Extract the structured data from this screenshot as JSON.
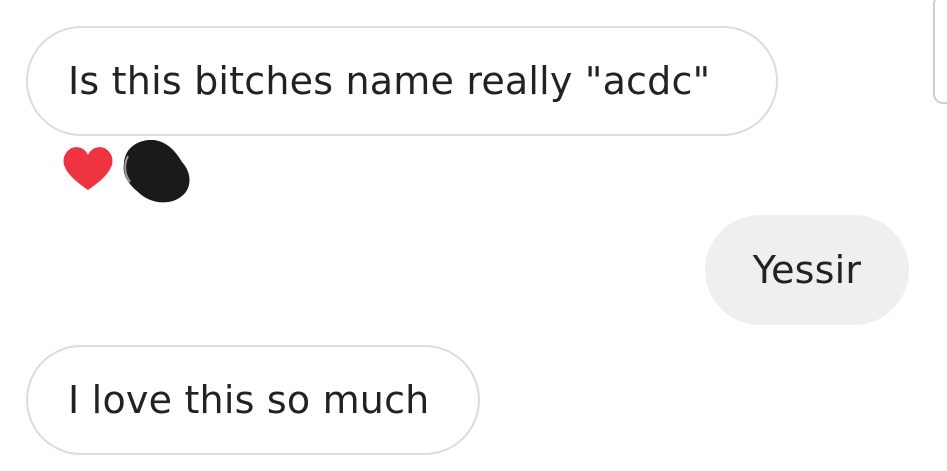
{
  "messages": [
    {
      "direction": "incoming",
      "text": "Is this bitches name really \"acdc\""
    },
    {
      "direction": "outgoing",
      "text": "Yessir"
    },
    {
      "direction": "incoming",
      "text": "I love this so much"
    }
  ],
  "reactions": {
    "first_message": [
      "heart-emoji",
      "redacted-avatar"
    ]
  },
  "colors": {
    "incoming_bubble_bg": "#ffffff",
    "incoming_bubble_border": "#dcdcdc",
    "outgoing_bubble_bg": "#efefef",
    "heart": "#ef3340",
    "redaction": "#1a1a1a",
    "text": "#222222"
  }
}
